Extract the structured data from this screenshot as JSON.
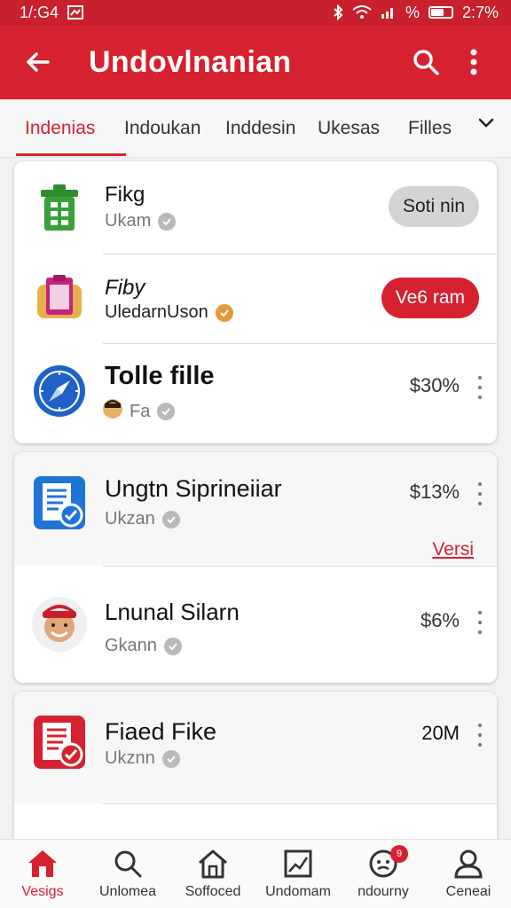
{
  "status_bar": {
    "time": "1/:G4",
    "battery": "%",
    "clock": "2:7%",
    "battery_level": 0.6
  },
  "app_bar": {
    "title": "Undovlnanian"
  },
  "tabs": [
    {
      "label": "Indenias",
      "active": true
    },
    {
      "label": "Indoukan"
    },
    {
      "label": "Inddesin"
    },
    {
      "label": "Ukesas"
    },
    {
      "label": "Filles"
    }
  ],
  "card1": {
    "rows": [
      {
        "title": "Fikg",
        "subtitle": "Ukam",
        "action": "Soti nin"
      },
      {
        "title": "Fiby",
        "subtitle": "UledarnUson",
        "action": "Ve6 ram"
      },
      {
        "title": "Tolle fille",
        "subtitle": "Fa",
        "percent": "$30%"
      }
    ]
  },
  "card2": {
    "rows": [
      {
        "title": "Ungtn Siprineiiar",
        "subtitle": "Ukzan",
        "percent": "$13%",
        "link": "Versi"
      },
      {
        "title": "Lnunal Silarn",
        "subtitle": "Gkann",
        "percent": "$6%"
      }
    ]
  },
  "card3": {
    "rows": [
      {
        "title": "Fiaed Fike",
        "subtitle": "Ukznn",
        "percent": "20M"
      }
    ]
  },
  "bottom_nav": [
    {
      "label": "Vesigs",
      "icon": "home-icon",
      "active": true
    },
    {
      "label": "Unlomea",
      "icon": "search-icon"
    },
    {
      "label": "Soffoced",
      "icon": "house-outline-icon"
    },
    {
      "label": "Undomam",
      "icon": "image-icon"
    },
    {
      "label": "ndourny",
      "icon": "face-icon",
      "badge": "9"
    },
    {
      "label": "Cenеai",
      "icon": "person-icon"
    }
  ],
  "colors": {
    "primary": "#d62130",
    "status": "#c8202c"
  }
}
